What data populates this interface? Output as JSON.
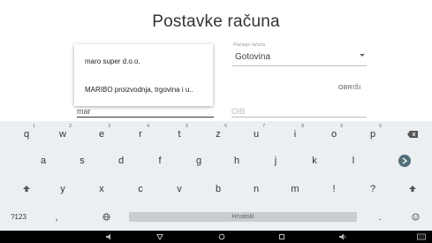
{
  "page": {
    "title": "Postavke računa"
  },
  "form": {
    "payment_label": "Plaćanje računa",
    "payment_value": "Gotovina",
    "delete_label": "OBRIŠI",
    "company_value": "mar",
    "oib_placeholder": "OIB"
  },
  "autocomplete": {
    "items": [
      "maro super d.o.o.",
      "MARIBO proizvodnja, trgovina i u.."
    ]
  },
  "keyboard": {
    "row1": [
      {
        "k": "q",
        "h": "1"
      },
      {
        "k": "w",
        "h": "2"
      },
      {
        "k": "e",
        "h": "3"
      },
      {
        "k": "r",
        "h": "4"
      },
      {
        "k": "t",
        "h": "5"
      },
      {
        "k": "z",
        "h": "6"
      },
      {
        "k": "u",
        "h": "7"
      },
      {
        "k": "i",
        "h": "8"
      },
      {
        "k": "o",
        "h": "9"
      },
      {
        "k": "p",
        "h": "0"
      }
    ],
    "row2": [
      "a",
      "s",
      "d",
      "f",
      "g",
      "h",
      "j",
      "k",
      "l"
    ],
    "row3": [
      "y",
      "x",
      "c",
      "v",
      "b",
      "n",
      "m",
      "!",
      "?"
    ],
    "mode_key": "?123",
    "comma_key": ",",
    "space_label": "Hrvatski",
    "period_key": "."
  },
  "colors": {
    "keyboard_bg": "#eceff1",
    "enter_bg": "#546e7a",
    "navbar_bg": "#000000"
  }
}
